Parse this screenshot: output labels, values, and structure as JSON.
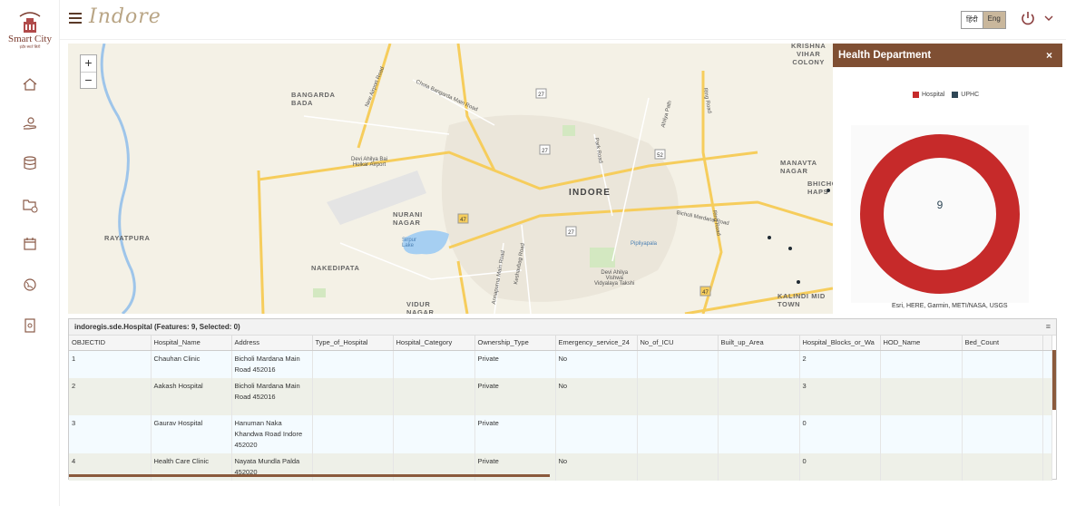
{
  "app": {
    "logo_text": "Smart City",
    "logo_tagline": "इंदौर स्मार्ट सिटी",
    "title": "Indore"
  },
  "header": {
    "lang_hindi": "हिंदी",
    "lang_english": "Eng"
  },
  "sidebar": {
    "icons": [
      "home-icon",
      "hand-coin-icon",
      "database-icon",
      "folder-add-icon",
      "calendar-icon",
      "globe-icon",
      "document-icon"
    ]
  },
  "map": {
    "zoom_in": "+",
    "zoom_out": "−",
    "labels": {
      "bangarda_bada": "BANGARDA\nBADA",
      "nurani_nagar": "NURANI\nNAGAR",
      "rayatpura": "RAYATPURA",
      "nakedipata": "NAKEDIPATA",
      "vidur_nagar": "VIDUR\nNAGAR",
      "indore": "INDORE",
      "krishna_vihar": "KRISHNA\nVIHAR\nCOLONY",
      "manavta_nagar": "MANAVTA\nNAGAR",
      "bhicholi_hapsi": "BHICHO\nHAPS",
      "kalindi": "KALINDI MID\nTOWN",
      "airport": "Devi Ahilya Bai\nHolkar Airport",
      "sirpur_lake": "Sirpur\nLake",
      "univ": "Devi Ahilya\nVishwa\nVidyalaya Takshi",
      "pipliyapala": "Pipliyapala"
    },
    "roads": {
      "new_airport_road": "New Airport Road",
      "chota_bangarda": "Chota Bangarda Main Road",
      "ring_road": "Ring Road",
      "ring_road2": "Ring Road",
      "park_road": "Park Road",
      "ahilya_path": "Ahilya Path",
      "bicholi_mardana": "Bicholi Mardana Road",
      "annapurna": "Annapurna Main Road",
      "keshavbag": "Keshavbag Road",
      "sanwer": "Sanwer Road"
    },
    "shields": [
      "27",
      "27",
      "52",
      "47",
      "27",
      "47"
    ]
  },
  "health_panel": {
    "title": "Health Department",
    "close": "×",
    "legend": [
      {
        "label": "Hospital",
        "color": "#c62a2a"
      },
      {
        "label": "UPHC",
        "color": "#2f4756"
      }
    ],
    "center_value": "9",
    "attribution": "Esri, HERE, Garmin, METI/NASA, USGS"
  },
  "chart_data": {
    "type": "pie",
    "categories": [
      "Hospital",
      "UPHC"
    ],
    "values": [
      9,
      0
    ],
    "total": 9,
    "legend": "top-center"
  },
  "table": {
    "caption": "indoregis.sde.Hospital (Features: 9, Selected: 0)",
    "columns": [
      "OBJECTID",
      "Hospital_Name",
      "Address",
      "Type_of_Hospital",
      "Hospital_Category",
      "Ownership_Type",
      "Emergency_service_24",
      "No_of_ICU",
      "Built_up_Area",
      "Hospital_Blocks_or_Wa",
      "HOD_Name",
      "Bed_Count",
      ""
    ],
    "rows": [
      {
        "id": "1",
        "name": "Chauhan Clinic",
        "address": "Bicholi Mardana Main Road 452016",
        "type": "",
        "category": "",
        "ownership": "Private",
        "emergency": "No",
        "icu": "",
        "area": "",
        "blocks": "2",
        "hod": "",
        "beds": ""
      },
      {
        "id": "2",
        "name": "Aakash Hospital",
        "address": "Bicholi Mardana Main Road 452016",
        "type": "",
        "category": "",
        "ownership": "Private",
        "emergency": "No",
        "icu": "",
        "area": "",
        "blocks": "3",
        "hod": "",
        "beds": ""
      },
      {
        "id": "3",
        "name": "Gaurav Hospital",
        "address": "Hanuman Naka Khandwa Road Indore 452020",
        "type": "",
        "category": "",
        "ownership": "Private",
        "emergency": "",
        "icu": "",
        "area": "",
        "blocks": "0",
        "hod": "",
        "beds": ""
      },
      {
        "id": "4",
        "name": "Health Care Clinic",
        "address": "Nayata Mundla Palda 452020",
        "type": "",
        "category": "",
        "ownership": "Private",
        "emergency": "No",
        "icu": "",
        "area": "",
        "blocks": "0",
        "hod": "",
        "beds": ""
      }
    ]
  }
}
